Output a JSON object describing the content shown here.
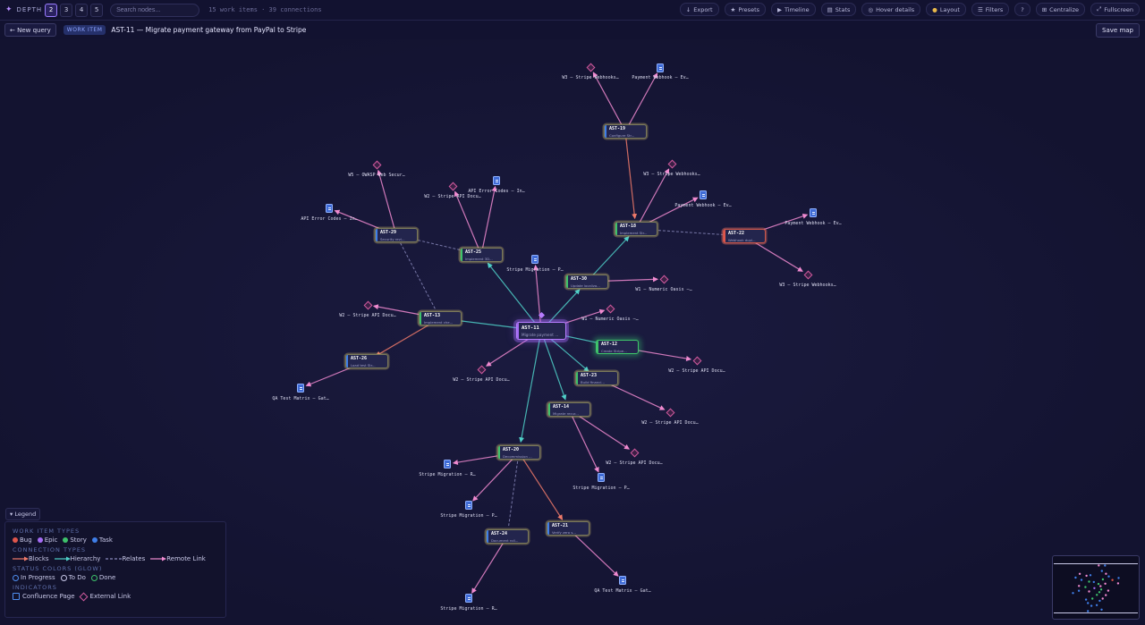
{
  "toolbar": {
    "depth_label": "DEPTH",
    "depth_options": [
      "2",
      "3",
      "4",
      "5"
    ],
    "depth_selected": "2",
    "search_placeholder": "Search nodes...",
    "stats": "15 work items · 39 connections",
    "buttons": [
      "Export",
      "Presets",
      "Timeline",
      "Stats",
      "Hover details",
      "Layout",
      "Filters",
      "?",
      "Centralize",
      "Fullscreen"
    ]
  },
  "querybar": {
    "new_query": "← New query",
    "badge": "WORK ITEM",
    "title": "AST-11 — Migrate payment gateway from PayPal to Stripe",
    "save": "Save map"
  },
  "colors": {
    "bug": "#e0564c",
    "epic": "#a66cf5",
    "story": "#3ec16b",
    "task": "#3f7ee8",
    "blocks": "#f07a6a",
    "hierarchy": "#4fd0c8",
    "relates": "#8888bb",
    "remote": "#f08ad0"
  },
  "nodes": [
    {
      "id": "AST-11",
      "title": "Migrate payment ...",
      "type": "epic"
    },
    {
      "id": "AST-19",
      "title": "Configure Str...",
      "type": "task"
    },
    {
      "id": "AST-18",
      "title": "Implement Str...",
      "type": "story"
    },
    {
      "id": "AST-22",
      "title": "Webhook dupl...",
      "type": "bug"
    },
    {
      "id": "AST-29",
      "title": "Security revi...",
      "type": "task"
    },
    {
      "id": "AST-25",
      "title": "Implement 3D...",
      "type": "story"
    },
    {
      "id": "AST-30",
      "title": "Update localiza...",
      "type": "story"
    },
    {
      "id": "AST-13",
      "title": "Implement che...",
      "type": "story"
    },
    {
      "id": "AST-12",
      "title": "Create Stripe...",
      "type": "story"
    },
    {
      "id": "AST-26",
      "title": "Load test Str...",
      "type": "task"
    },
    {
      "id": "AST-23",
      "title": "Build financi...",
      "type": "story"
    },
    {
      "id": "AST-14",
      "title": "Migrate recur...",
      "type": "story"
    },
    {
      "id": "AST-20",
      "title": "Decommission ...",
      "type": "story"
    },
    {
      "id": "AST-21",
      "title": "Verify zero s...",
      "type": "task"
    },
    {
      "id": "AST-24",
      "title": "Document roll...",
      "type": "task"
    }
  ],
  "leaves": [
    {
      "label": "W3 – Stripe Webhooks…",
      "kind": "ext"
    },
    {
      "label": "Payment Webhook – Ev…",
      "kind": "conf"
    },
    {
      "label": "W3 – Stripe Webhooks…",
      "kind": "ext"
    },
    {
      "label": "Payment Webhook – Ev…",
      "kind": "conf"
    },
    {
      "label": "Payment Webhook – Ev…",
      "kind": "conf"
    },
    {
      "label": "W3 – Stripe Webhooks…",
      "kind": "ext"
    },
    {
      "label": "W5 – OWASP Web Secur…",
      "kind": "ext"
    },
    {
      "label": "API Error Codes – In…",
      "kind": "conf"
    },
    {
      "label": "W2 – Stripe API Docu…",
      "kind": "ext"
    },
    {
      "label": "API Error Codes – In…",
      "kind": "conf"
    },
    {
      "label": "Stripe Migration – P…",
      "kind": "conf"
    },
    {
      "label": "W1 – Numeric Oasis –…",
      "kind": "ext"
    },
    {
      "label": "W1 – Numeric Oasis –…",
      "kind": "ext"
    },
    {
      "label": "W2 – Stripe API Docu…",
      "kind": "ext"
    },
    {
      "label": "QA Test Matrix – Gat…",
      "kind": "conf"
    },
    {
      "label": "W2 – Stripe API Docu…",
      "kind": "ext"
    },
    {
      "label": "W2 – Stripe API Docu…",
      "kind": "ext"
    },
    {
      "label": "W2 – Stripe API Docu…",
      "kind": "ext"
    },
    {
      "label": "W2 – Stripe API Docu…",
      "kind": "ext"
    },
    {
      "label": "Stripe Migration – R…",
      "kind": "conf"
    },
    {
      "label": "Stripe Migration – P…",
      "kind": "conf"
    },
    {
      "label": "Stripe Migration – P…",
      "kind": "conf"
    },
    {
      "label": "QA Test Matrix – Gat…",
      "kind": "conf"
    },
    {
      "label": "Stripe Migration – R…",
      "kind": "conf"
    }
  ],
  "legend": {
    "toggle": "▾ Legend",
    "types_title": "WORK ITEM TYPES",
    "types": [
      "Bug",
      "Epic",
      "Story",
      "Task"
    ],
    "conn_title": "CONNECTION TYPES",
    "conns": [
      "Blocks",
      "Hierarchy",
      "Relates",
      "Remote Link"
    ],
    "status_title": "STATUS COLORS (GLOW)",
    "statuses": [
      "In Progress",
      "To Do",
      "Done"
    ],
    "ind_title": "INDICATORS",
    "indicators": [
      "Confluence Page",
      "External Link"
    ]
  }
}
